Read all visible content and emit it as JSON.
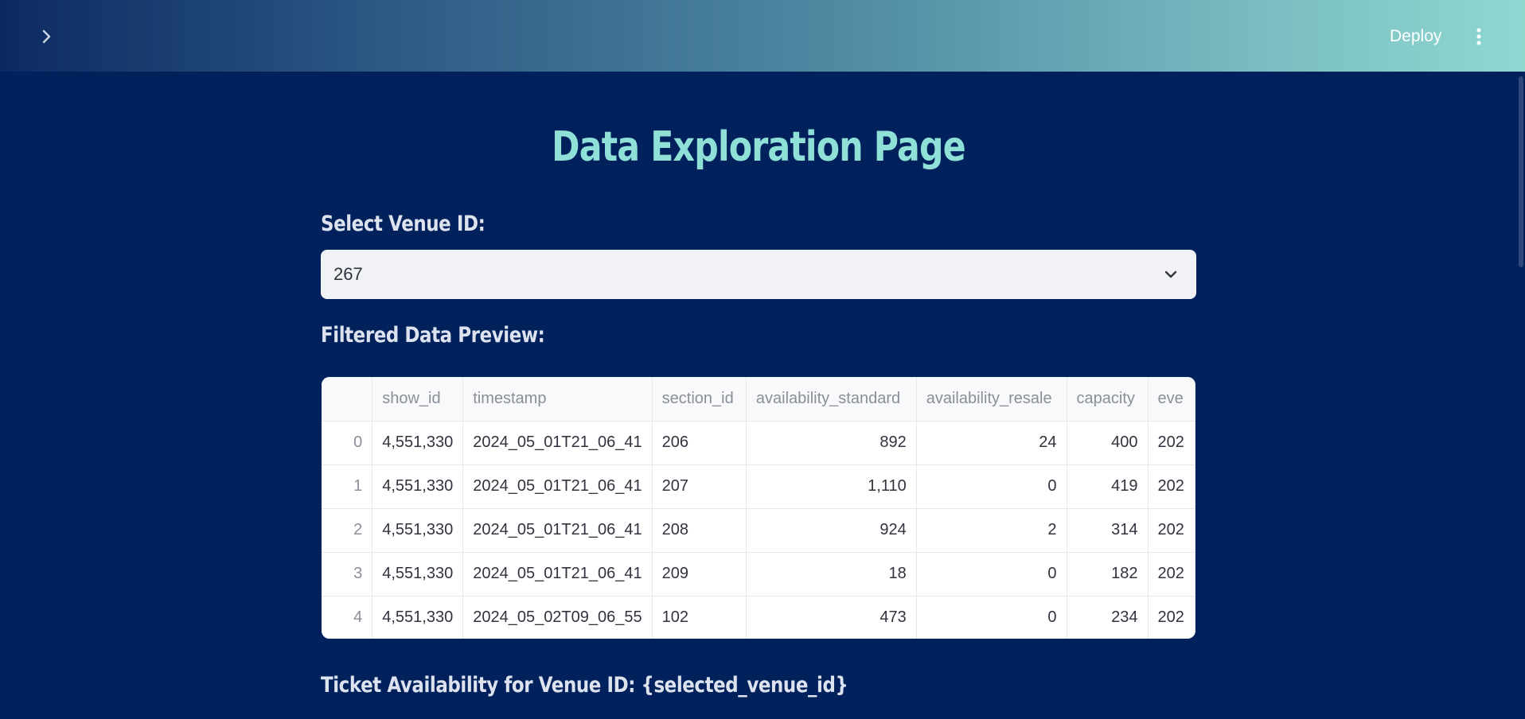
{
  "header": {
    "deploy_label": "Deploy"
  },
  "page": {
    "title": "Data Exploration Page",
    "venue_label": "Select Venue ID:",
    "venue_selected": "267",
    "preview_label": "Filtered Data Preview:",
    "ticket_label": "Ticket Availability for Venue ID: {selected_venue_id}"
  },
  "table": {
    "columns": [
      "",
      "show_id",
      "timestamp",
      "section_id",
      "availability_standard",
      "availability_resale",
      "capacity",
      "eve"
    ],
    "rows": [
      [
        "0",
        "4,551,330",
        "2024_05_01T21_06_41",
        "206",
        "892",
        "24",
        "400",
        "202"
      ],
      [
        "1",
        "4,551,330",
        "2024_05_01T21_06_41",
        "207",
        "1,110",
        "0",
        "419",
        "202"
      ],
      [
        "2",
        "4,551,330",
        "2024_05_01T21_06_41",
        "208",
        "924",
        "2",
        "314",
        "202"
      ],
      [
        "3",
        "4,551,330",
        "2024_05_01T21_06_41",
        "209",
        "18",
        "0",
        "182",
        "202"
      ],
      [
        "4",
        "4,551,330",
        "2024_05_02T09_06_55",
        "102",
        "473",
        "0",
        "234",
        "202"
      ]
    ]
  },
  "colors": {
    "background": "#00215c",
    "title": "#8fe1d8",
    "label": "#dde3ee"
  },
  "icons": {
    "sidebar_toggle": "chevron-right-icon",
    "menu": "kebab-menu-icon",
    "select": "chevron-down-icon"
  }
}
